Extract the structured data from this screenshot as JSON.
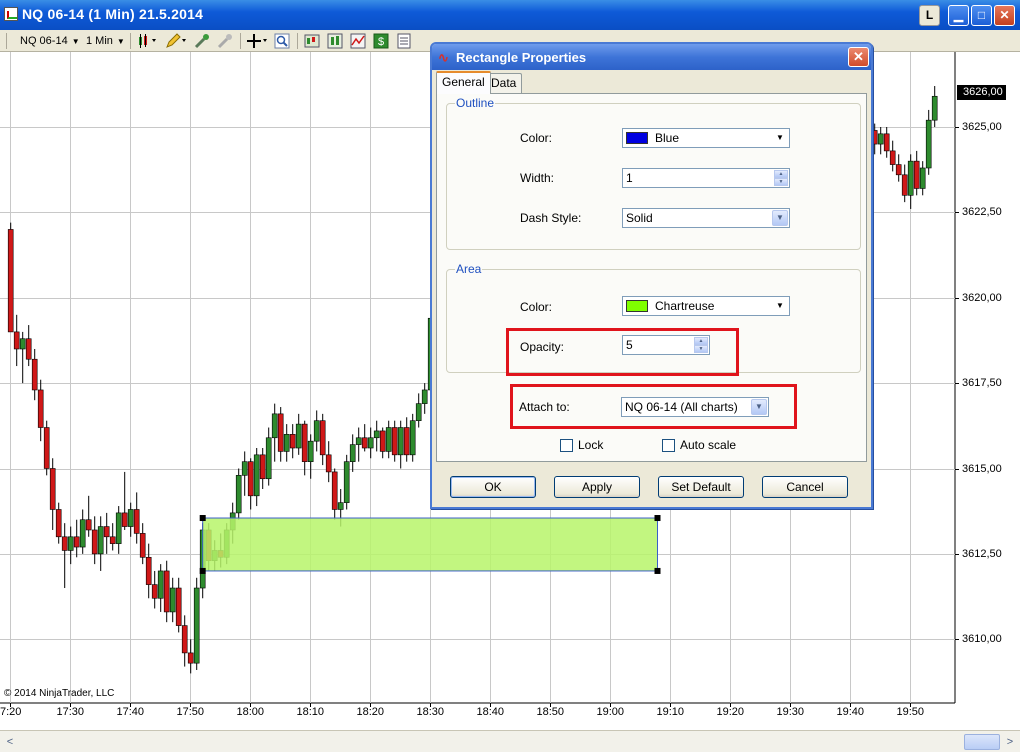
{
  "window": {
    "title": "NQ 06-14 (1 Min)  21.5.2014",
    "l_button": "L",
    "min_glyph": "▁",
    "max_glyph": "□",
    "close_glyph": "✕"
  },
  "toolbar": {
    "instrument": "NQ 06-14",
    "interval": "1 Min",
    "icons": [
      "bar-type-icon",
      "draw-pencil-icon",
      "zoom-in-icon",
      "zoom-out-icon",
      "crosshair-icon",
      "magnify-icon",
      "chart-trader-icon",
      "data-box-icon",
      "indicators-icon",
      "strategies-icon",
      "properties-icon"
    ]
  },
  "chart": {
    "copyright": "© 2014 NinjaTrader, LLC",
    "last_price": "3626,00",
    "up_color": "#2e8b2e",
    "down_color": "#d01818",
    "rect_fill": "#b7f46a",
    "rect_stroke": "#3b5fc8"
  },
  "chart_data": {
    "type": "candlestick",
    "y_tick_labels": [
      "3625,00",
      "3622,50",
      "3620,00",
      "3617,50",
      "3615,00",
      "3612,50",
      "3610,00"
    ],
    "y_ticks": [
      3625,
      3622.5,
      3620,
      3617.5,
      3615,
      3612.5,
      3610
    ],
    "x_tick_labels": [
      "7:20",
      "17:30",
      "17:40",
      "17:50",
      "18:00",
      "18:10",
      "18:20",
      "18:30",
      "18:40",
      "18:50",
      "19:00",
      "19:10",
      "19:20",
      "19:30",
      "19:40",
      "19:50"
    ],
    "x_tick_minutes": [
      20,
      30,
      40,
      50,
      60,
      70,
      80,
      90,
      100,
      110,
      120,
      130,
      140,
      150,
      160,
      170
    ],
    "grid": true,
    "last_price": 3626.0,
    "rectangle": {
      "x_start_minute": 52.2,
      "x_end_minute": 128.0,
      "y_low": 3612.0,
      "y_high": 3613.55,
      "color": "Chartreuse",
      "opacity": 5
    },
    "candles": [
      {
        "t": 20.2,
        "o": 3622.0,
        "h": 3622.2,
        "l": 3619.0,
        "c": 3619.0
      },
      {
        "t": 21.2,
        "o": 3619.0,
        "h": 3619.5,
        "l": 3618.0,
        "c": 3618.5
      },
      {
        "t": 22.2,
        "o": 3618.5,
        "h": 3619.0,
        "l": 3617.5,
        "c": 3618.8
      },
      {
        "t": 23.2,
        "o": 3618.8,
        "h": 3619.2,
        "l": 3618.0,
        "c": 3618.2
      },
      {
        "t": 24.2,
        "o": 3618.2,
        "h": 3618.5,
        "l": 3617.0,
        "c": 3617.3
      },
      {
        "t": 25.2,
        "o": 3617.3,
        "h": 3617.6,
        "l": 3615.8,
        "c": 3616.2
      },
      {
        "t": 26.2,
        "o": 3616.2,
        "h": 3616.4,
        "l": 3614.8,
        "c": 3615.0
      },
      {
        "t": 27.2,
        "o": 3615.0,
        "h": 3615.3,
        "l": 3613.2,
        "c": 3613.8
      },
      {
        "t": 28.2,
        "o": 3613.8,
        "h": 3614.0,
        "l": 3612.8,
        "c": 3613.0
      },
      {
        "t": 29.2,
        "o": 3613.0,
        "h": 3613.4,
        "l": 3611.5,
        "c": 3612.6
      },
      {
        "t": 30.2,
        "o": 3612.6,
        "h": 3613.3,
        "l": 3612.2,
        "c": 3613.0
      },
      {
        "t": 31.2,
        "o": 3613.0,
        "h": 3613.5,
        "l": 3612.4,
        "c": 3612.7
      },
      {
        "t": 32.2,
        "o": 3612.7,
        "h": 3613.8,
        "l": 3612.5,
        "c": 3613.5
      },
      {
        "t": 33.2,
        "o": 3613.5,
        "h": 3614.2,
        "l": 3613.0,
        "c": 3613.2
      },
      {
        "t": 34.2,
        "o": 3613.2,
        "h": 3613.6,
        "l": 3612.2,
        "c": 3612.5
      },
      {
        "t": 35.2,
        "o": 3612.5,
        "h": 3613.6,
        "l": 3612.0,
        "c": 3613.3
      },
      {
        "t": 36.2,
        "o": 3613.3,
        "h": 3613.7,
        "l": 3612.5,
        "c": 3613.0
      },
      {
        "t": 37.2,
        "o": 3613.0,
        "h": 3613.4,
        "l": 3612.6,
        "c": 3612.8
      },
      {
        "t": 38.2,
        "o": 3612.8,
        "h": 3613.9,
        "l": 3612.5,
        "c": 3613.7
      },
      {
        "t": 39.2,
        "o": 3613.7,
        "h": 3614.9,
        "l": 3613.2,
        "c": 3613.3
      },
      {
        "t": 40.2,
        "o": 3613.3,
        "h": 3614.0,
        "l": 3613.0,
        "c": 3613.8
      },
      {
        "t": 41.2,
        "o": 3613.8,
        "h": 3614.3,
        "l": 3612.8,
        "c": 3613.1
      },
      {
        "t": 42.2,
        "o": 3613.1,
        "h": 3613.4,
        "l": 3612.2,
        "c": 3612.4
      },
      {
        "t": 43.2,
        "o": 3612.4,
        "h": 3612.8,
        "l": 3611.2,
        "c": 3611.6
      },
      {
        "t": 44.2,
        "o": 3611.6,
        "h": 3612.0,
        "l": 3610.9,
        "c": 3611.2
      },
      {
        "t": 45.2,
        "o": 3611.2,
        "h": 3612.2,
        "l": 3610.8,
        "c": 3612.0
      },
      {
        "t": 46.2,
        "o": 3612.0,
        "h": 3612.3,
        "l": 3610.5,
        "c": 3610.8
      },
      {
        "t": 47.2,
        "o": 3610.8,
        "h": 3611.8,
        "l": 3610.5,
        "c": 3611.5
      },
      {
        "t": 48.2,
        "o": 3611.5,
        "h": 3611.8,
        "l": 3610.2,
        "c": 3610.4
      },
      {
        "t": 49.2,
        "o": 3610.4,
        "h": 3610.7,
        "l": 3609.2,
        "c": 3609.6
      },
      {
        "t": 50.2,
        "o": 3609.6,
        "h": 3610.0,
        "l": 3609.0,
        "c": 3609.3
      },
      {
        "t": 51.2,
        "o": 3609.3,
        "h": 3611.8,
        "l": 3609.1,
        "c": 3611.5
      },
      {
        "t": 52.2,
        "o": 3611.5,
        "h": 3613.4,
        "l": 3611.2,
        "c": 3613.2
      },
      {
        "t": 53.2,
        "o": 3613.2,
        "h": 3613.4,
        "l": 3612.0,
        "c": 3612.3
      },
      {
        "t": 54.2,
        "o": 3612.3,
        "h": 3612.9,
        "l": 3612.0,
        "c": 3612.6
      },
      {
        "t": 55.2,
        "o": 3612.6,
        "h": 3613.1,
        "l": 3612.1,
        "c": 3612.4
      },
      {
        "t": 56.2,
        "o": 3612.4,
        "h": 3613.4,
        "l": 3612.2,
        "c": 3613.2
      },
      {
        "t": 57.2,
        "o": 3613.2,
        "h": 3614.0,
        "l": 3612.8,
        "c": 3613.7
      },
      {
        "t": 58.2,
        "o": 3613.7,
        "h": 3615.0,
        "l": 3613.5,
        "c": 3614.8
      },
      {
        "t": 59.2,
        "o": 3614.8,
        "h": 3615.5,
        "l": 3614.2,
        "c": 3615.2
      },
      {
        "t": 60.2,
        "o": 3615.2,
        "h": 3615.3,
        "l": 3613.8,
        "c": 3614.2
      },
      {
        "t": 61.2,
        "o": 3614.2,
        "h": 3615.6,
        "l": 3613.9,
        "c": 3615.4
      },
      {
        "t": 62.2,
        "o": 3615.4,
        "h": 3615.6,
        "l": 3614.4,
        "c": 3614.7
      },
      {
        "t": 63.2,
        "o": 3614.7,
        "h": 3616.2,
        "l": 3614.5,
        "c": 3615.9
      },
      {
        "t": 64.2,
        "o": 3615.9,
        "h": 3616.9,
        "l": 3615.2,
        "c": 3616.6
      },
      {
        "t": 65.2,
        "o": 3616.6,
        "h": 3616.8,
        "l": 3615.2,
        "c": 3615.5
      },
      {
        "t": 66.2,
        "o": 3615.5,
        "h": 3616.3,
        "l": 3615.2,
        "c": 3616.0
      },
      {
        "t": 67.2,
        "o": 3616.0,
        "h": 3616.3,
        "l": 3615.3,
        "c": 3615.6
      },
      {
        "t": 68.2,
        "o": 3615.6,
        "h": 3616.6,
        "l": 3615.4,
        "c": 3616.3
      },
      {
        "t": 69.2,
        "o": 3616.3,
        "h": 3616.4,
        "l": 3614.8,
        "c": 3615.2
      },
      {
        "t": 70.2,
        "o": 3615.2,
        "h": 3616.0,
        "l": 3614.7,
        "c": 3615.8
      },
      {
        "t": 71.2,
        "o": 3615.8,
        "h": 3616.7,
        "l": 3615.5,
        "c": 3616.4
      },
      {
        "t": 72.2,
        "o": 3616.4,
        "h": 3616.6,
        "l": 3615.1,
        "c": 3615.4
      },
      {
        "t": 73.2,
        "o": 3615.4,
        "h": 3615.8,
        "l": 3614.6,
        "c": 3614.9
      },
      {
        "t": 74.2,
        "o": 3614.9,
        "h": 3615.0,
        "l": 3613.5,
        "c": 3613.8
      },
      {
        "t": 75.2,
        "o": 3613.8,
        "h": 3614.4,
        "l": 3613.3,
        "c": 3614.0
      },
      {
        "t": 76.2,
        "o": 3614.0,
        "h": 3615.4,
        "l": 3613.8,
        "c": 3615.2
      },
      {
        "t": 77.2,
        "o": 3615.2,
        "h": 3616.0,
        "l": 3614.9,
        "c": 3615.7
      },
      {
        "t": 78.2,
        "o": 3615.7,
        "h": 3616.2,
        "l": 3615.2,
        "c": 3615.9
      },
      {
        "t": 79.2,
        "o": 3615.9,
        "h": 3616.3,
        "l": 3615.5,
        "c": 3615.6
      },
      {
        "t": 80.2,
        "o": 3615.6,
        "h": 3616.2,
        "l": 3615.3,
        "c": 3615.9
      },
      {
        "t": 81.2,
        "o": 3615.9,
        "h": 3616.4,
        "l": 3615.5,
        "c": 3616.1
      },
      {
        "t": 82.2,
        "o": 3616.1,
        "h": 3616.2,
        "l": 3615.3,
        "c": 3615.5
      },
      {
        "t": 83.2,
        "o": 3615.5,
        "h": 3616.4,
        "l": 3615.3,
        "c": 3616.2
      },
      {
        "t": 84.2,
        "o": 3616.2,
        "h": 3616.4,
        "l": 3615.2,
        "c": 3615.4
      },
      {
        "t": 85.2,
        "o": 3615.4,
        "h": 3616.4,
        "l": 3615.0,
        "c": 3616.2
      },
      {
        "t": 86.2,
        "o": 3616.2,
        "h": 3616.5,
        "l": 3615.2,
        "c": 3615.4
      },
      {
        "t": 87.2,
        "o": 3615.4,
        "h": 3616.6,
        "l": 3615.2,
        "c": 3616.4
      },
      {
        "t": 88.2,
        "o": 3616.4,
        "h": 3617.2,
        "l": 3616.2,
        "c": 3616.9
      },
      {
        "t": 89.2,
        "o": 3616.9,
        "h": 3617.5,
        "l": 3616.6,
        "c": 3617.3
      },
      {
        "t": 90.2,
        "o": 3617.3,
        "h": 3619.6,
        "l": 3617.2,
        "c": 3619.4
      },
      {
        "t": 91.2,
        "o": 3619.4,
        "h": 3620.0,
        "l": 3618.7,
        "c": 3619.0
      },
      {
        "t": 92.2,
        "o": 3619.0,
        "h": 3619.8,
        "l": 3618.8,
        "c": 3619.6
      },
      {
        "t": 93.2,
        "o": 3619.6,
        "h": 3620.2,
        "l": 3619.3,
        "c": 3619.9
      },
      {
        "t": 164.2,
        "o": 3624.9,
        "h": 3625.1,
        "l": 3624.2,
        "c": 3624.5
      },
      {
        "t": 165.2,
        "o": 3624.5,
        "h": 3625.0,
        "l": 3624.2,
        "c": 3624.8
      },
      {
        "t": 166.2,
        "o": 3624.8,
        "h": 3625.0,
        "l": 3624.1,
        "c": 3624.3
      },
      {
        "t": 167.2,
        "o": 3624.3,
        "h": 3624.6,
        "l": 3623.7,
        "c": 3623.9
      },
      {
        "t": 168.2,
        "o": 3623.9,
        "h": 3624.2,
        "l": 3623.4,
        "c": 3623.6
      },
      {
        "t": 169.2,
        "o": 3623.6,
        "h": 3623.9,
        "l": 3622.8,
        "c": 3623.0
      },
      {
        "t": 170.2,
        "o": 3623.0,
        "h": 3624.2,
        "l": 3622.6,
        "c": 3624.0
      },
      {
        "t": 171.2,
        "o": 3624.0,
        "h": 3624.3,
        "l": 3623.0,
        "c": 3623.2
      },
      {
        "t": 172.2,
        "o": 3623.2,
        "h": 3624.0,
        "l": 3623.0,
        "c": 3623.8
      },
      {
        "t": 173.2,
        "o": 3623.8,
        "h": 3625.5,
        "l": 3623.6,
        "c": 3625.2
      },
      {
        "t": 174.2,
        "o": 3625.2,
        "h": 3626.2,
        "l": 3625.0,
        "c": 3625.9
      }
    ]
  },
  "dialog": {
    "title": "Rectangle Properties",
    "close_glyph": "✕",
    "tabs": [
      {
        "label": "General"
      },
      {
        "label": "Data"
      }
    ],
    "outline": {
      "group_label": "Outline",
      "color_label": "Color:",
      "color_value": "Blue",
      "color_swatch": "#0000e0",
      "width_label": "Width:",
      "width_value": "1",
      "dash_label": "Dash Style:",
      "dash_value": "Solid"
    },
    "area": {
      "group_label": "Area",
      "color_label": "Color:",
      "color_value": "Chartreuse",
      "color_swatch": "#7fff00",
      "opacity_label": "Opacity:",
      "opacity_value": "5"
    },
    "attach_label": "Attach to:",
    "attach_value": "NQ 06-14 (All charts)",
    "lock_label": "Lock",
    "autoscale_label": "Auto scale",
    "buttons": {
      "ok": "OK",
      "apply": "Apply",
      "set_default": "Set Default",
      "cancel": "Cancel"
    },
    "highlight_color": "#e0141c"
  },
  "scrollbar": {
    "left_glyph": "<",
    "right_glyph": ">"
  }
}
